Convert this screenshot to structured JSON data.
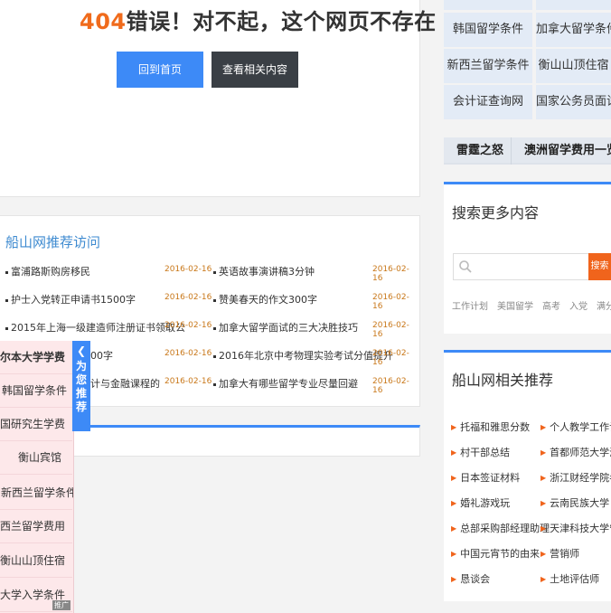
{
  "error": {
    "code": "404",
    "message": "错误！对不起，这个网页不存在",
    "home_button": "回到首页",
    "related_button": "查看相关内容"
  },
  "recommended": {
    "title": "船山网推荐访问",
    "items": [
      {
        "text": "富浦路斯购房移民",
        "date": "2016-02-16"
      },
      {
        "text": "英语故事演讲稿3分钟",
        "date": "2016-02-16"
      },
      {
        "text": "护士入党转正申请书1500字",
        "date": "2016-02-16"
      },
      {
        "text": "赞美春天的作文300字",
        "date": "2016-02-16"
      },
      {
        "text": "2015年上海一级建造师注册证书领取公",
        "date": "2016-02-16"
      },
      {
        "text": "加拿大留学面试的三大决胜技巧",
        "date": "2016-02-16"
      },
      {
        "text": "00字",
        "date": "2016-02-16"
      },
      {
        "text": "2016年北京中考物理实验考试分值提升",
        "date": "2016-02-16"
      },
      {
        "text": "计与金融课程的",
        "date": "2016-02-16"
      },
      {
        "text": "加拿大有哪些留学专业尽量回避",
        "date": "2016-02-16"
      }
    ]
  },
  "right_grid": [
    "韩国留学条件",
    "加拿大留学条件",
    "新西兰留学条件",
    "衡山山顶住宿",
    "会计证查询网",
    "国家公务员面试"
  ],
  "tabs": [
    "雷霆之怒",
    "澳洲留学费用一览表"
  ],
  "search": {
    "title": "搜索更多内容",
    "placeholder": "",
    "button": "搜索",
    "hot_tags": [
      "工作计划",
      "美国留学",
      "高考",
      "入党",
      "满分作文"
    ]
  },
  "related": {
    "title": "船山网相关推荐",
    "items": [
      "托福和雅思分数",
      "个人教学工作计划",
      "村干部总结",
      "首都师范大学海南录",
      "日本签证材料",
      "浙江财经学院考研调",
      "婚礼游戏玩",
      "云南民族大学",
      "总部采购部经理助理",
      "天津科技大学宁夏录",
      "中国元宵节的由来",
      "营销师",
      "恳谈会",
      "土地评估师"
    ]
  },
  "float_panel": {
    "tab_label": "为您推荐",
    "items": [
      "尔本大学学费",
      "韩国留学条件",
      "国研究生学费",
      "衡山宾馆",
      "新西兰留学条件",
      "西兰留学费用",
      "衡山山顶住宿",
      "大学入学条件"
    ],
    "ad_label": "推广"
  },
  "colors": {
    "accent": "#3d8af7",
    "orange": "#f06b1c",
    "dark_button": "#3a3f45",
    "float_bg": "#fde8ea",
    "grid_bg": "#e3ebf6"
  }
}
